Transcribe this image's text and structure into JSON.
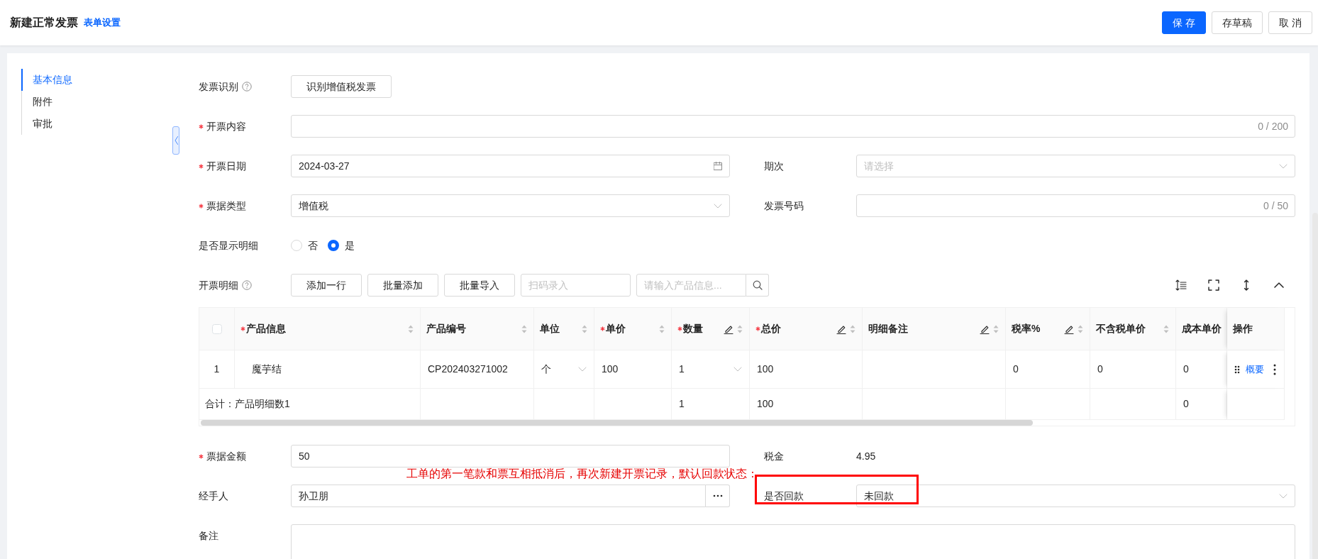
{
  "header": {
    "title": "新建正常发票",
    "link": "表单设置",
    "buttons": [
      {
        "label": "保 存",
        "kind": "primary"
      },
      {
        "label": "存草稿",
        "kind": "default"
      },
      {
        "label": "取 消",
        "kind": "default"
      }
    ]
  },
  "sidebar": {
    "items": [
      {
        "label": "基本信息",
        "selected": true
      },
      {
        "label": "附件",
        "selected": false
      },
      {
        "label": "审批",
        "selected": false
      }
    ]
  },
  "form": {
    "rows_top": [
      {
        "fields": [
          {
            "kind": "button",
            "label": "发票识别",
            "help": true,
            "required": false,
            "button": "识别增值税发票"
          }
        ]
      },
      {
        "fields": [
          {
            "kind": "text",
            "label": "开票内容",
            "required": true,
            "counter": "0 / 200"
          }
        ]
      },
      {
        "fields": [
          {
            "kind": "date",
            "label": "开票日期",
            "required": true,
            "value": "2024-03-27"
          },
          {
            "kind": "select",
            "label": "期次",
            "required": false,
            "placeholder": "请选择"
          }
        ]
      },
      {
        "fields": [
          {
            "kind": "select",
            "label": "票据类型",
            "required": true,
            "value": "增值税"
          },
          {
            "kind": "text",
            "label": "发票号码",
            "required": false,
            "counter": "0 / 50"
          }
        ]
      },
      {
        "fields": [
          {
            "kind": "radio",
            "label": "是否显示明细",
            "required": false,
            "options": [
              {
                "label": "否",
                "selected": false
              },
              {
                "label": "是",
                "selected": true
              }
            ]
          }
        ]
      },
      {
        "fields": [
          {
            "kind": "toolbar",
            "label": "开票明细",
            "help": true,
            "required": false,
            "buttons": [
              "添加一行",
              "批量添加",
              "批量导入"
            ],
            "scan_placeholder": "扫码录入",
            "search_placeholder": "请输入产品信息..."
          }
        ]
      }
    ],
    "table": {
      "header_checkbox": {
        "checked": false
      },
      "columns": [
        {
          "label": "产品信息",
          "required": true,
          "editable": false,
          "sortable": true
        },
        {
          "label": "产品编号",
          "required": false,
          "editable": false,
          "sortable": true
        },
        {
          "label": "单位",
          "required": false,
          "editable": false,
          "sortable": true
        },
        {
          "label": "单价",
          "required": true,
          "editable": false,
          "sortable": true
        },
        {
          "label": "数量",
          "required": true,
          "editable": true,
          "sortable": true
        },
        {
          "label": "总价",
          "required": true,
          "editable": true,
          "sortable": true
        },
        {
          "label": "明细备注",
          "required": false,
          "editable": true,
          "sortable": true
        },
        {
          "label": "税率%",
          "required": false,
          "editable": true,
          "sortable": true
        },
        {
          "label": "不含税单价",
          "required": false,
          "editable": false,
          "sortable": true
        },
        {
          "label": "成本单价",
          "required": false,
          "editable": false,
          "sortable": false
        }
      ],
      "action_column": "操作",
      "rows": [
        {
          "index": "1",
          "cells": [
            {
              "kind": "text",
              "value": "魔芋结"
            },
            {
              "kind": "text",
              "value": "CP202403271002"
            },
            {
              "kind": "select",
              "value": "个"
            },
            {
              "kind": "text",
              "value": "100"
            },
            {
              "kind": "select",
              "value": "1"
            },
            {
              "kind": "text",
              "value": "100"
            },
            {
              "kind": "text"
            },
            {
              "kind": "text",
              "value": "0"
            },
            {
              "kind": "text",
              "value": "0"
            },
            {
              "kind": "text",
              "value": "0"
            }
          ],
          "action": "概要"
        }
      ],
      "summary": {
        "label": "合计：产品明细数1",
        "cells": [
          "",
          "",
          "",
          "1",
          "100",
          "",
          "",
          "",
          "0"
        ]
      }
    },
    "rows_bottom": [
      {
        "fields": [
          {
            "kind": "text",
            "label": "票据金额",
            "required": true,
            "value": "50"
          },
          {
            "kind": "static",
            "label": "税金",
            "required": false,
            "value": "4.95"
          }
        ]
      },
      {
        "fields": [
          {
            "kind": "lookup",
            "label": "经手人",
            "required": false,
            "value": "孙卫朋"
          },
          {
            "kind": "select",
            "label": "是否回款",
            "required": false,
            "value": "未回款",
            "highlighted": true
          }
        ]
      },
      {
        "fields": [
          {
            "kind": "textarea",
            "label": "备注",
            "required": false
          }
        ]
      }
    ]
  },
  "annotation": {
    "text": "工单的第一笔款和票互相抵消后，再次新建开票记录，默认回款状态："
  }
}
